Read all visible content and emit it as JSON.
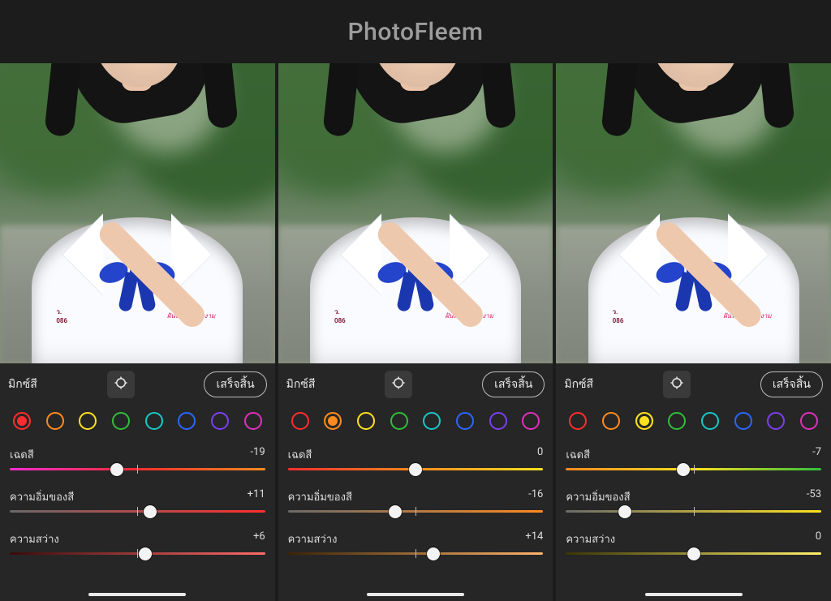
{
  "brand": "PhotoFleem",
  "swatch_colors": [
    "#ff2d2d",
    "#ff8a1f",
    "#ffe11f",
    "#2fbf3a",
    "#19c6c6",
    "#2a67ff",
    "#7a3ff0",
    "#e22fbd"
  ],
  "panels": [
    {
      "title": "มิกซ์สี",
      "done_label": "เสร็จสิ้น",
      "active_swatch": 0,
      "sliders": [
        {
          "label": "เฉดสี",
          "value": -19,
          "valueText": "-19",
          "pos": 42,
          "gradient": [
            "#ff2dd1",
            "#ff2d2d",
            "#ff8a1f"
          ]
        },
        {
          "label": "ความอิ่มของสี",
          "value": 11,
          "valueText": "+11",
          "pos": 55,
          "gradient": [
            "#6a6a6a",
            "#ff2d2d"
          ]
        },
        {
          "label": "ความสว่าง",
          "value": 6,
          "valueText": "+6",
          "pos": 53,
          "gradient": [
            "#3a0a0a",
            "#ff6b6b"
          ]
        }
      ]
    },
    {
      "title": "มิกซ์สี",
      "done_label": "เสร็จสิ้น",
      "active_swatch": 1,
      "sliders": [
        {
          "label": "เฉดสี",
          "value": 0,
          "valueText": "0",
          "pos": 50,
          "gradient": [
            "#ff2d2d",
            "#ff8a1f",
            "#ffe11f"
          ]
        },
        {
          "label": "ความอิ่มของสี",
          "value": -16,
          "valueText": "-16",
          "pos": 42,
          "gradient": [
            "#6a6a6a",
            "#ff8a1f"
          ]
        },
        {
          "label": "ความสว่าง",
          "value": 14,
          "valueText": "+14",
          "pos": 57,
          "gradient": [
            "#3a2305",
            "#ffb36b"
          ]
        }
      ]
    },
    {
      "title": "มิกซ์สี",
      "done_label": "เสร็จสิ้น",
      "active_swatch": 2,
      "sliders": [
        {
          "label": "เฉดสี",
          "value": -7,
          "valueText": "-7",
          "pos": 46,
          "gradient": [
            "#ff8a1f",
            "#ffe11f",
            "#2fbf3a"
          ]
        },
        {
          "label": "ความอิ่มของสี",
          "value": -53,
          "valueText": "-53",
          "pos": 23,
          "gradient": [
            "#6a6a6a",
            "#ffe11f"
          ]
        },
        {
          "label": "ความสว่าง",
          "value": 0,
          "valueText": "0",
          "pos": 50,
          "gradient": [
            "#3a3405",
            "#fff06b"
          ]
        }
      ]
    }
  ]
}
